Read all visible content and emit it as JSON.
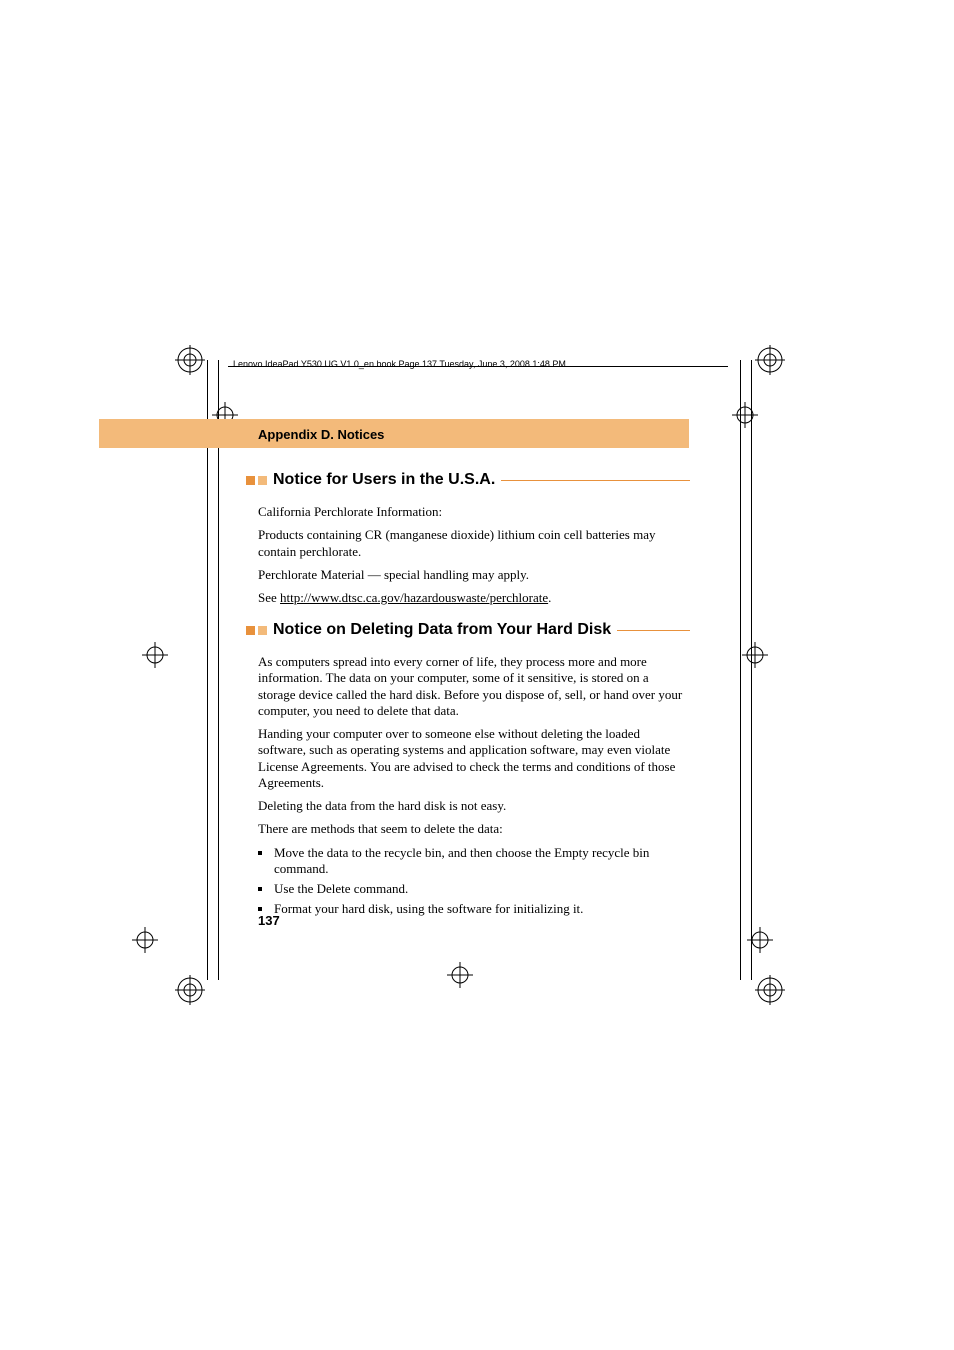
{
  "header_line": "Lenovo IdeaPad Y530 UG V1.0_en.book  Page 137  Tuesday, June 3, 2008  1:48 PM",
  "appendix_title": "Appendix D. Notices",
  "section1": {
    "title": "Notice for Users in the U.S.A.",
    "p1": "California Perchlorate Information:",
    "p2": "Products containing CR (manganese dioxide) lithium coin cell batteries may contain perchlorate.",
    "p3": "Perchlorate Material — special handling may apply.",
    "p4_prefix": "See ",
    "p4_link": "http://www.dtsc.ca.gov/hazardouswaste/perchlorate",
    "p4_suffix": "."
  },
  "section2": {
    "title": "Notice on Deleting Data from Your Hard Disk",
    "p1": "As computers spread into every corner of life, they process more and more information. The data on your computer, some of it sensitive, is stored on a storage device called the hard disk. Before you dispose of, sell, or hand over your computer, you need to delete that data.",
    "p2": "Handing your computer over to someone else without deleting the loaded software, such as operating systems and application software, may even violate License Agreements. You are advised to check the terms and conditions of those Agreements.",
    "p3": "Deleting the data from the hard disk is not easy.",
    "p4": "There are methods that seem to delete the data:",
    "bullets": [
      "Move the data to the recycle bin, and then choose the Empty recycle bin command.",
      "Use the Delete command.",
      "Format your hard disk, using the software for initializing it."
    ]
  },
  "page_number": "137"
}
